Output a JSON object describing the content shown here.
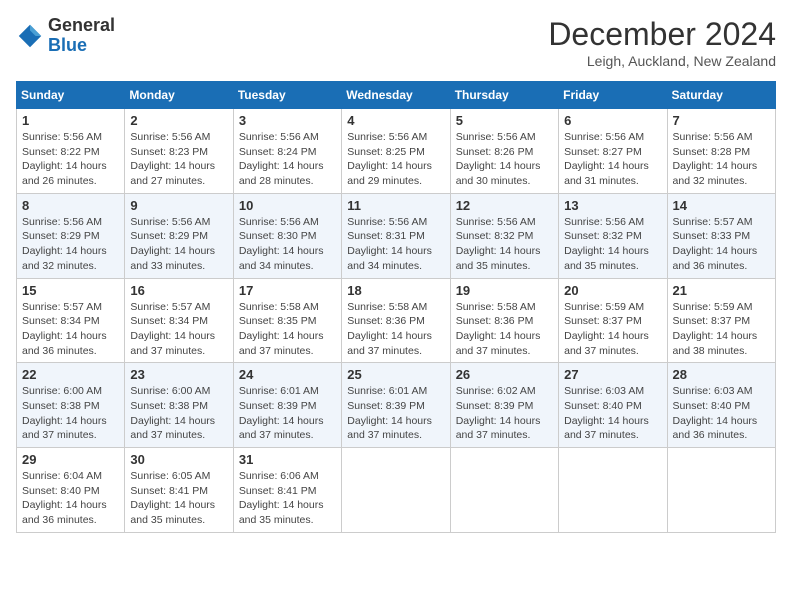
{
  "header": {
    "logo_line1": "General",
    "logo_line2": "Blue",
    "month_title": "December 2024",
    "location": "Leigh, Auckland, New Zealand"
  },
  "weekdays": [
    "Sunday",
    "Monday",
    "Tuesday",
    "Wednesday",
    "Thursday",
    "Friday",
    "Saturday"
  ],
  "weeks": [
    [
      {
        "day": "1",
        "sunrise": "5:56 AM",
        "sunset": "8:22 PM",
        "daylight": "14 hours and 26 minutes."
      },
      {
        "day": "2",
        "sunrise": "5:56 AM",
        "sunset": "8:23 PM",
        "daylight": "14 hours and 27 minutes."
      },
      {
        "day": "3",
        "sunrise": "5:56 AM",
        "sunset": "8:24 PM",
        "daylight": "14 hours and 28 minutes."
      },
      {
        "day": "4",
        "sunrise": "5:56 AM",
        "sunset": "8:25 PM",
        "daylight": "14 hours and 29 minutes."
      },
      {
        "day": "5",
        "sunrise": "5:56 AM",
        "sunset": "8:26 PM",
        "daylight": "14 hours and 30 minutes."
      },
      {
        "day": "6",
        "sunrise": "5:56 AM",
        "sunset": "8:27 PM",
        "daylight": "14 hours and 31 minutes."
      },
      {
        "day": "7",
        "sunrise": "5:56 AM",
        "sunset": "8:28 PM",
        "daylight": "14 hours and 32 minutes."
      }
    ],
    [
      {
        "day": "8",
        "sunrise": "5:56 AM",
        "sunset": "8:29 PM",
        "daylight": "14 hours and 32 minutes."
      },
      {
        "day": "9",
        "sunrise": "5:56 AM",
        "sunset": "8:29 PM",
        "daylight": "14 hours and 33 minutes."
      },
      {
        "day": "10",
        "sunrise": "5:56 AM",
        "sunset": "8:30 PM",
        "daylight": "14 hours and 34 minutes."
      },
      {
        "day": "11",
        "sunrise": "5:56 AM",
        "sunset": "8:31 PM",
        "daylight": "14 hours and 34 minutes."
      },
      {
        "day": "12",
        "sunrise": "5:56 AM",
        "sunset": "8:32 PM",
        "daylight": "14 hours and 35 minutes."
      },
      {
        "day": "13",
        "sunrise": "5:56 AM",
        "sunset": "8:32 PM",
        "daylight": "14 hours and 35 minutes."
      },
      {
        "day": "14",
        "sunrise": "5:57 AM",
        "sunset": "8:33 PM",
        "daylight": "14 hours and 36 minutes."
      }
    ],
    [
      {
        "day": "15",
        "sunrise": "5:57 AM",
        "sunset": "8:34 PM",
        "daylight": "14 hours and 36 minutes."
      },
      {
        "day": "16",
        "sunrise": "5:57 AM",
        "sunset": "8:34 PM",
        "daylight": "14 hours and 37 minutes."
      },
      {
        "day": "17",
        "sunrise": "5:58 AM",
        "sunset": "8:35 PM",
        "daylight": "14 hours and 37 minutes."
      },
      {
        "day": "18",
        "sunrise": "5:58 AM",
        "sunset": "8:36 PM",
        "daylight": "14 hours and 37 minutes."
      },
      {
        "day": "19",
        "sunrise": "5:58 AM",
        "sunset": "8:36 PM",
        "daylight": "14 hours and 37 minutes."
      },
      {
        "day": "20",
        "sunrise": "5:59 AM",
        "sunset": "8:37 PM",
        "daylight": "14 hours and 37 minutes."
      },
      {
        "day": "21",
        "sunrise": "5:59 AM",
        "sunset": "8:37 PM",
        "daylight": "14 hours and 38 minutes."
      }
    ],
    [
      {
        "day": "22",
        "sunrise": "6:00 AM",
        "sunset": "8:38 PM",
        "daylight": "14 hours and 37 minutes."
      },
      {
        "day": "23",
        "sunrise": "6:00 AM",
        "sunset": "8:38 PM",
        "daylight": "14 hours and 37 minutes."
      },
      {
        "day": "24",
        "sunrise": "6:01 AM",
        "sunset": "8:39 PM",
        "daylight": "14 hours and 37 minutes."
      },
      {
        "day": "25",
        "sunrise": "6:01 AM",
        "sunset": "8:39 PM",
        "daylight": "14 hours and 37 minutes."
      },
      {
        "day": "26",
        "sunrise": "6:02 AM",
        "sunset": "8:39 PM",
        "daylight": "14 hours and 37 minutes."
      },
      {
        "day": "27",
        "sunrise": "6:03 AM",
        "sunset": "8:40 PM",
        "daylight": "14 hours and 37 minutes."
      },
      {
        "day": "28",
        "sunrise": "6:03 AM",
        "sunset": "8:40 PM",
        "daylight": "14 hours and 36 minutes."
      }
    ],
    [
      {
        "day": "29",
        "sunrise": "6:04 AM",
        "sunset": "8:40 PM",
        "daylight": "14 hours and 36 minutes."
      },
      {
        "day": "30",
        "sunrise": "6:05 AM",
        "sunset": "8:41 PM",
        "daylight": "14 hours and 35 minutes."
      },
      {
        "day": "31",
        "sunrise": "6:06 AM",
        "sunset": "8:41 PM",
        "daylight": "14 hours and 35 minutes."
      },
      null,
      null,
      null,
      null
    ]
  ]
}
